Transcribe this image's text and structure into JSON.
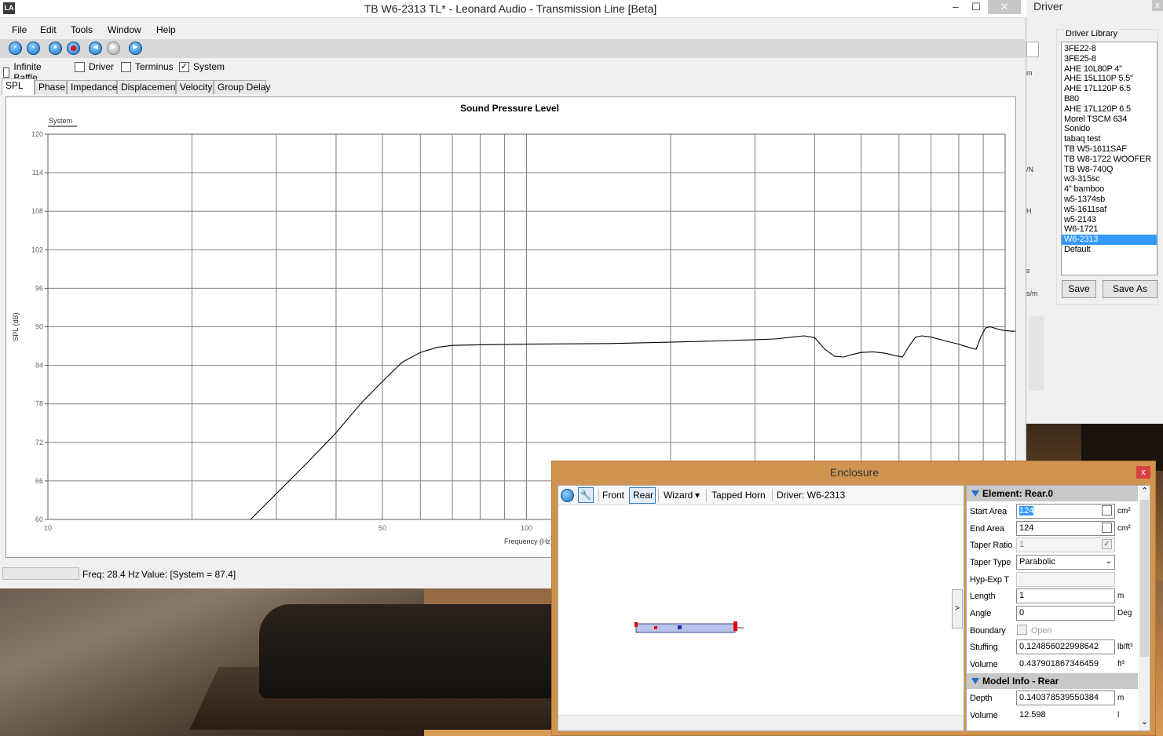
{
  "main_window": {
    "title": "TB W6-2313 TL* - Leonard Audio - Transmission Line [Beta]",
    "logo_text": "LA",
    "controls": {
      "minimize": "–",
      "maximize": "☐",
      "close": "✕"
    },
    "menu": [
      "File",
      "Edit",
      "Tools",
      "Window",
      "Help"
    ],
    "toolbar_icons": [
      "new-icon",
      "open-icon",
      "record-stop-icon",
      "record-icon",
      "rewind-icon",
      "pause-icon",
      "play-icon"
    ],
    "checkboxes": [
      {
        "label": "Infinite Baffle",
        "checked": false
      },
      {
        "label": "Driver",
        "checked": false
      },
      {
        "label": "Terminus",
        "checked": false
      },
      {
        "label": "System",
        "checked": true
      }
    ],
    "tabs": [
      "SPL",
      "Phase",
      "Impedance",
      "Displacement",
      "Velocity",
      "Group Delay"
    ],
    "active_tab": "SPL",
    "status": {
      "freq": "Freq: 28.4 Hz",
      "value": "Value: [System = 87.4]"
    }
  },
  "chart_data": {
    "type": "line",
    "title": "Sound Pressure Level",
    "xlabel": "Frequency (Hz)",
    "ylabel": "SPL (dB)",
    "x_scale": "log",
    "xlim": [
      10,
      1000
    ],
    "ylim": [
      60,
      120
    ],
    "x_tick_labels": [
      {
        "value": 10,
        "label": "10"
      },
      {
        "value": 50,
        "label": "50"
      },
      {
        "value": 100,
        "label": "100"
      }
    ],
    "y_ticks": [
      60,
      66,
      72,
      78,
      84,
      90,
      96,
      102,
      108,
      114,
      120
    ],
    "grid": true,
    "legend": "top-left",
    "series": [
      {
        "name": "System",
        "color": "#000000",
        "points": [
          [
            26.5,
            60
          ],
          [
            30,
            64
          ],
          [
            35,
            69
          ],
          [
            40,
            73.5
          ],
          [
            45,
            78
          ],
          [
            50,
            81.5
          ],
          [
            55,
            84.5
          ],
          [
            60,
            86
          ],
          [
            65,
            86.8
          ],
          [
            70,
            87.1
          ],
          [
            80,
            87.2
          ],
          [
            100,
            87.3
          ],
          [
            150,
            87.4
          ],
          [
            200,
            87.6
          ],
          [
            250,
            87.8
          ],
          [
            300,
            88
          ],
          [
            330,
            88.1
          ],
          [
            360,
            88.4
          ],
          [
            380,
            88.6
          ],
          [
            400,
            88.3
          ],
          [
            420,
            86.5
          ],
          [
            440,
            85.4
          ],
          [
            460,
            85.3
          ],
          [
            480,
            85.7
          ],
          [
            500,
            86
          ],
          [
            530,
            86.1
          ],
          [
            560,
            85.9
          ],
          [
            590,
            85.5
          ],
          [
            610,
            85.3
          ],
          [
            630,
            87
          ],
          [
            650,
            88.4
          ],
          [
            670,
            88.6
          ],
          [
            700,
            88.4
          ],
          [
            750,
            87.8
          ],
          [
            800,
            87.3
          ],
          [
            840,
            86.8
          ],
          [
            870,
            86.5
          ],
          [
            890,
            88.5
          ],
          [
            910,
            89.8
          ],
          [
            930,
            90
          ],
          [
            960,
            89.7
          ],
          [
            1000,
            89.4
          ],
          [
            1040,
            89.3
          ],
          [
            1080,
            89.4
          ],
          [
            1110,
            89.4
          ],
          [
            1140,
            88.2
          ],
          [
            1170,
            87.5
          ],
          [
            1200,
            87.3
          ],
          [
            1250,
            87.7
          ],
          [
            1300,
            88
          ],
          [
            1330,
            88.2
          ]
        ]
      }
    ]
  },
  "driver_window": {
    "title": "Driver",
    "close": "x",
    "partial_labels": [
      "m",
      "/N",
      "H",
      "s",
      "s/m"
    ],
    "library_label": "Driver Library",
    "library": [
      "3FE22-8",
      "3FE25-8",
      "AHE 10L80P 4\"",
      "AHE 15L110P 5.5\"",
      "AHE 17L120P 6.5",
      "B80",
      "AHE 17L120P 6.5",
      "Morel TSCM 634",
      "Sonido",
      "tabaq test",
      "TB W5-1611SAF",
      "TB W8-1722 WOOFER",
      "TB W8-740Q",
      "w3-315sc",
      "4\" bamboo",
      "w5-1374sb",
      "w5-1611saf",
      "w5-2143",
      "W6-1721",
      "W6-2313",
      "Default"
    ],
    "selected": "W6-2313",
    "save_label": "Save",
    "save_as_label": "Save As"
  },
  "enclosure_window": {
    "title": "Enclosure",
    "close": "x",
    "toolbar": {
      "front": "Front",
      "rear": "Rear",
      "wizard": "Wizard",
      "wizard_caret": "▾",
      "tapped_horn": "Tapped Horn",
      "driver": "Driver: W6-2313"
    },
    "expand_glyph": ">",
    "element_header": "Element: Rear.0",
    "props": {
      "start_area": {
        "label": "Start Area",
        "value": "124",
        "unit": "cm²"
      },
      "end_area": {
        "label": "End Area",
        "value": "124",
        "unit": "cm²"
      },
      "taper_ratio": {
        "label": "Taper Ratio",
        "value": "1"
      },
      "taper_type": {
        "label": "Taper Type",
        "value": "Parabolic"
      },
      "hyp_exp": {
        "label": "Hyp-Exp T",
        "value": ""
      },
      "length": {
        "label": "Length",
        "value": "1",
        "unit": "m"
      },
      "angle": {
        "label": "Angle",
        "value": "0",
        "unit": "Deg"
      },
      "boundary": {
        "label": "Boundary",
        "value": "Open"
      },
      "stuffing": {
        "label": "Stuffing",
        "value": "0.124856022998642",
        "unit": "lb/ft³"
      },
      "volume": {
        "label": "Volume",
        "value": "0.437901867346459",
        "unit": "ft³"
      }
    },
    "model_header": "Model Info - Rear",
    "model": {
      "depth": {
        "label": "Depth",
        "value": "0.140378539550384",
        "unit": "m"
      },
      "volume": {
        "label": "Volume",
        "value": "12.598",
        "unit": "l"
      }
    },
    "scroll_up": "⌃",
    "scroll_down": "⌄"
  }
}
